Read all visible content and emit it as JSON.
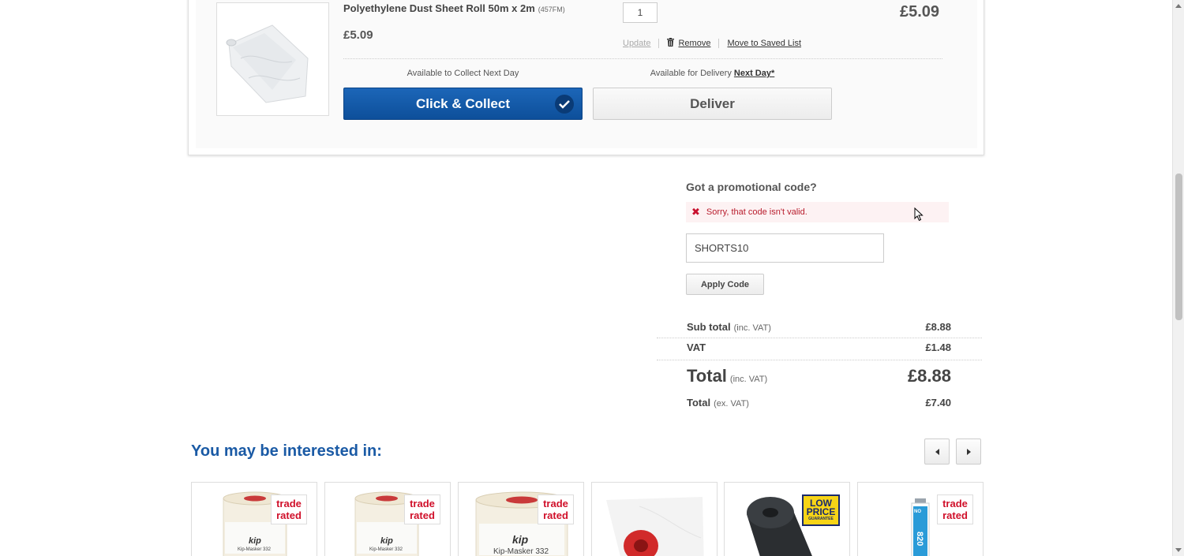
{
  "basket_item": {
    "name": "Polyethylene Dust Sheet Roll 50m x 2m",
    "code": "(457FM)",
    "unit_price": "£5.09",
    "quantity": "1",
    "line_price": "£5.09",
    "update_label": "Update",
    "remove_label": "Remove",
    "save_label": "Move to Saved List",
    "collect_availability": "Available to Collect Next Day",
    "delivery_availability_prefix": "Available for Delivery",
    "delivery_availability_link": "Next Day*",
    "collect_button": "Click & Collect",
    "deliver_button": "Deliver"
  },
  "promo": {
    "title": "Got a promotional code?",
    "error": "Sorry, that code isn't valid.",
    "code_value": "SHORTS10",
    "apply_button": "Apply Code"
  },
  "totals": {
    "subtotal_label": "Sub total",
    "subtotal_note": "(inc. VAT)",
    "subtotal_value": "£8.88",
    "vat_label": "VAT",
    "vat_value": "£1.48",
    "total_label": "Total",
    "total_note": "(inc. VAT)",
    "total_value": "£8.88",
    "total_ex_label": "Total",
    "total_ex_note": "(ex. VAT)",
    "total_ex_value": "£7.40"
  },
  "recommendations": {
    "title": "You may be interested in:",
    "badge_trade_line1": "trade",
    "badge_trade_line2": "rated",
    "badge_low_line1": "LOW",
    "badge_low_line2": "PRICE",
    "badge_low_line3": "GUARANTEE",
    "product_brand": "kip",
    "product_label": "Kip-Masker 332",
    "product_side_label": "NO",
    "product_side_number": "820"
  },
  "colors": {
    "primary_blue": "#0d4f9a",
    "heading_blue": "#1a5aa5",
    "error_red": "#c8102e"
  }
}
